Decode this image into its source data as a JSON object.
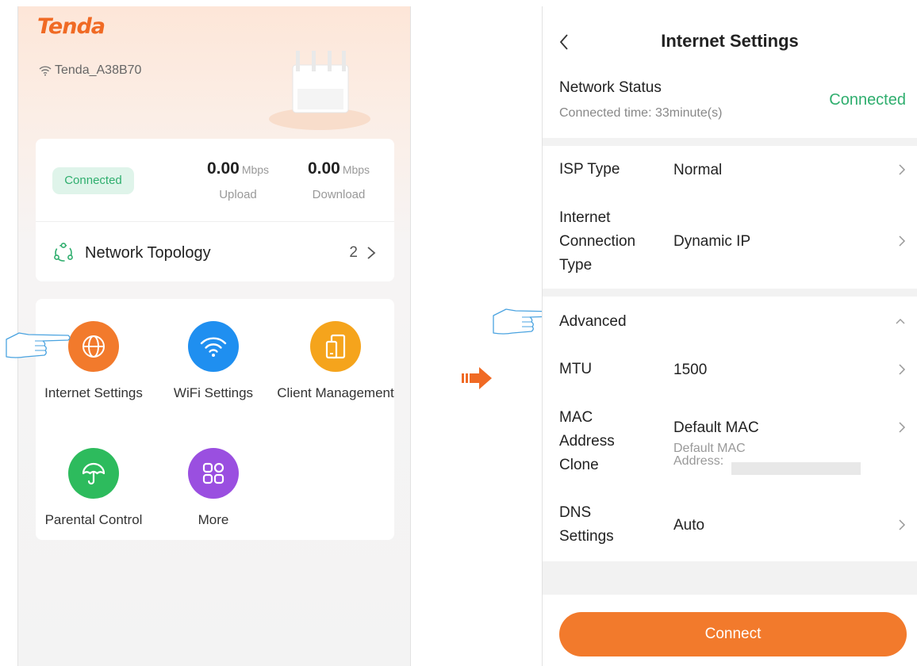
{
  "left": {
    "brand": "Tenda",
    "ssid": "Tenda_A38B70",
    "status_badge": "Connected",
    "upload": {
      "value": "0.00",
      "unit": "Mbps",
      "label": "Upload"
    },
    "download": {
      "value": "0.00",
      "unit": "Mbps",
      "label": "Download"
    },
    "topology": {
      "label": "Network Topology",
      "count": "2"
    },
    "apps": [
      {
        "label": "Internet Settings",
        "icon": "globe-icon",
        "color": "#f27a2c"
      },
      {
        "label": "WiFi Settings",
        "icon": "wifi-icon",
        "color": "#1f8ff0"
      },
      {
        "label": "Client Management",
        "icon": "device-icon",
        "color": "#f5a41c"
      },
      {
        "label": "Parental Control",
        "icon": "umbrella-icon",
        "color": "#2dbb5d"
      },
      {
        "label": "More",
        "icon": "grid-icon",
        "color": "#9a4fe0"
      }
    ]
  },
  "right": {
    "title": "Internet Settings",
    "network_status": {
      "label": "Network Status",
      "time": "Connected time: 33minute(s)",
      "value": "Connected"
    },
    "isp_type": {
      "label": "ISP Type",
      "value": "Normal"
    },
    "connection_type": {
      "label_lines": [
        "Internet",
        "Connection",
        "Type"
      ],
      "value": "Dynamic IP"
    },
    "advanced": {
      "label": "Advanced"
    },
    "mtu": {
      "label": "MTU",
      "value": "1500"
    },
    "mac_clone": {
      "label_lines": [
        "MAC",
        "Address",
        "Clone"
      ],
      "value": "Default MAC",
      "sub_lines": [
        "Default MAC",
        "Address:"
      ]
    },
    "dns": {
      "label_lines": [
        "DNS",
        "Settings"
      ],
      "value": "Auto"
    },
    "connect_button": "Connect"
  },
  "colors": {
    "brand_orange": "#f06a24",
    "connected_green": "#2fae6e",
    "button_orange": "#f27a2c"
  }
}
